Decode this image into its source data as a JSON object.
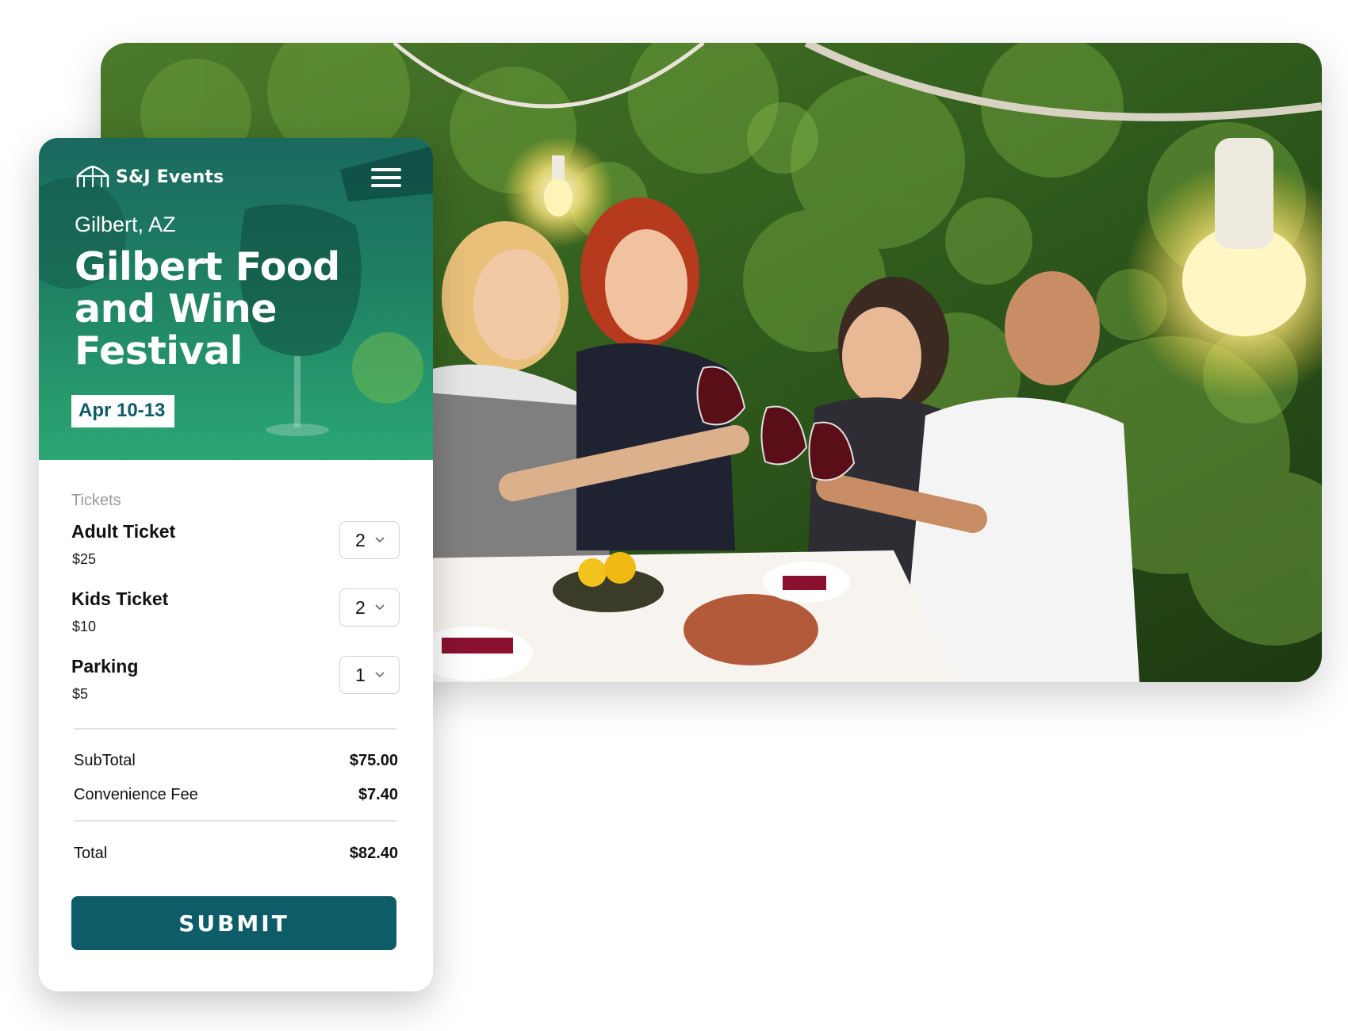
{
  "brand": {
    "name": "S&J Events",
    "icon": "tent-icon"
  },
  "header": {
    "menu_icon": "hamburger-menu-icon"
  },
  "event": {
    "location": "Gilbert, AZ",
    "title": "Gilbert Food and Wine Festival",
    "date": "Apr 10-13"
  },
  "tickets": {
    "label": "Tickets",
    "items": [
      {
        "name": "Adult Ticket",
        "price": "$25",
        "quantity": "2"
      },
      {
        "name": "Kids Ticket",
        "price": "$10",
        "quantity": "2"
      },
      {
        "name": "Parking",
        "price": "$5",
        "quantity": "1"
      }
    ]
  },
  "summary": {
    "subtotal_label": "SubTotal",
    "subtotal": "$75.00",
    "fee_label": "Convenience Fee",
    "fee": "$7.40",
    "total_label": "Total",
    "total": "$82.40"
  },
  "submit_label": "SUBMIT",
  "colors": {
    "primary": "#0f5c69",
    "hero_gradient_top": "#1b6b63",
    "hero_gradient_bottom": "#2aa372",
    "badge_text": "#0d5b66"
  }
}
